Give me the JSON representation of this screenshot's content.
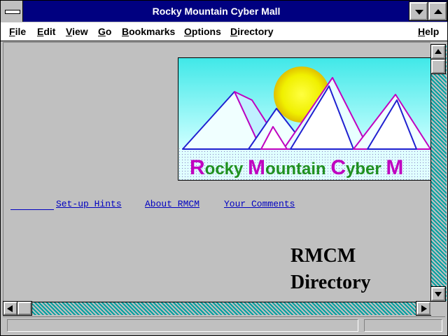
{
  "window": {
    "title": "Rocky Mountain Cyber Mall"
  },
  "menubar": {
    "items": [
      {
        "first": "F",
        "rest": "ile"
      },
      {
        "first": "E",
        "rest": "dit"
      },
      {
        "first": "V",
        "rest": "iew"
      },
      {
        "first": "G",
        "rest": "o"
      },
      {
        "first": "B",
        "rest": "ookmarks"
      },
      {
        "first": "O",
        "rest": "ptions"
      },
      {
        "first": "D",
        "rest": "irectory"
      },
      {
        "first": "H",
        "rest": "elp"
      }
    ]
  },
  "banner": {
    "text_R": "R",
    "text_1": "ocky ",
    "text_M": "M",
    "text_2": "ountain ",
    "text_C": "C",
    "text_3": "yber ",
    "text_M2": "M"
  },
  "links": {
    "setup": "Set-up Hints",
    "about": "About RMCM",
    "comments": "Your Comments"
  },
  "content": {
    "heading_line1": "RMCM",
    "heading_line2": "Directory"
  },
  "colors": {
    "titlebar": "#000080",
    "link": "#0000c0",
    "scroll_track": "#00a0a0"
  }
}
